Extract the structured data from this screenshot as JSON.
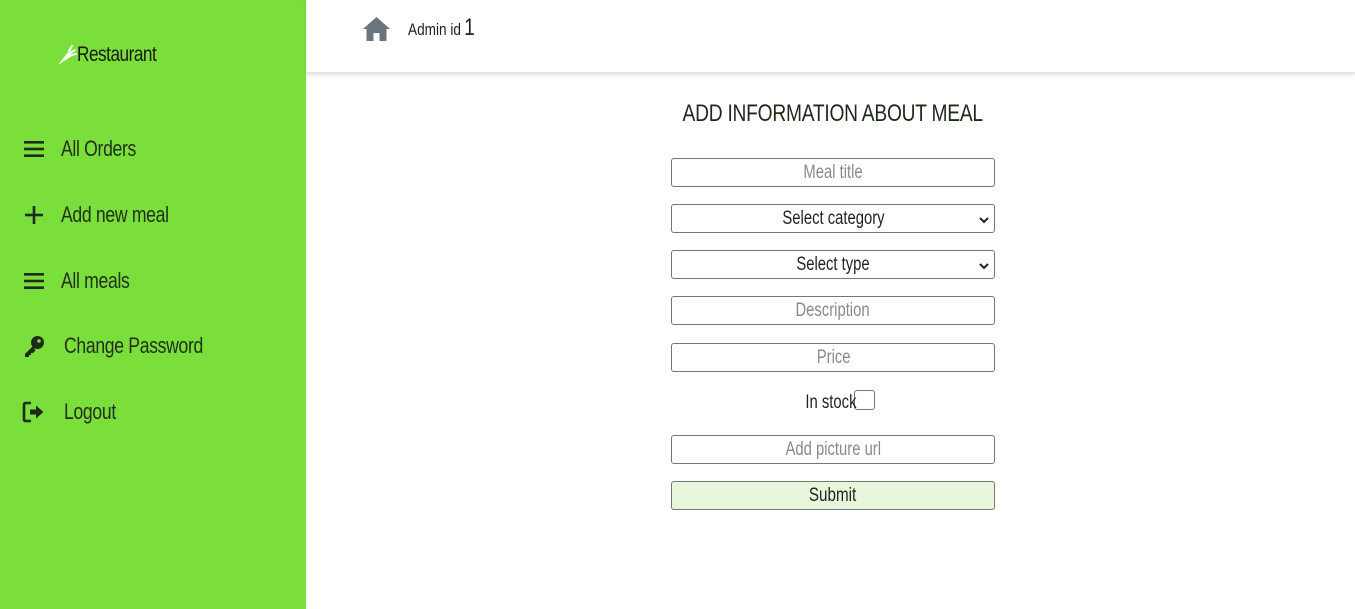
{
  "brand": {
    "name": "Restaurant",
    "icon": "carrot-icon"
  },
  "sidebar": {
    "items": [
      {
        "label": "All Orders",
        "icon": "list-icon"
      },
      {
        "label": "Add new meal",
        "icon": "plus-icon"
      },
      {
        "label": "All meals",
        "icon": "list-icon"
      },
      {
        "label": "Change Password",
        "icon": "key-icon"
      },
      {
        "label": "Logout",
        "icon": "logout-icon"
      }
    ]
  },
  "header": {
    "admin_label": "Admin id",
    "admin_id": "1",
    "home_icon": "home-icon"
  },
  "form": {
    "title": "ADD INFORMATION ABOUT MEAL",
    "meal_title_placeholder": "Meal title",
    "category_selected": "Select category",
    "type_selected": "Select type",
    "description_placeholder": "Description",
    "price_placeholder": "Price",
    "in_stock_label": "In stock",
    "in_stock_checked": false,
    "picture_placeholder": "Add picture url",
    "submit_label": "Submit"
  },
  "colors": {
    "sidebar_bg": "#7ade3b",
    "submit_bg": "#e8f6dc",
    "icon_dark": "#1e2a1a",
    "home_icon": "#6b7580"
  }
}
